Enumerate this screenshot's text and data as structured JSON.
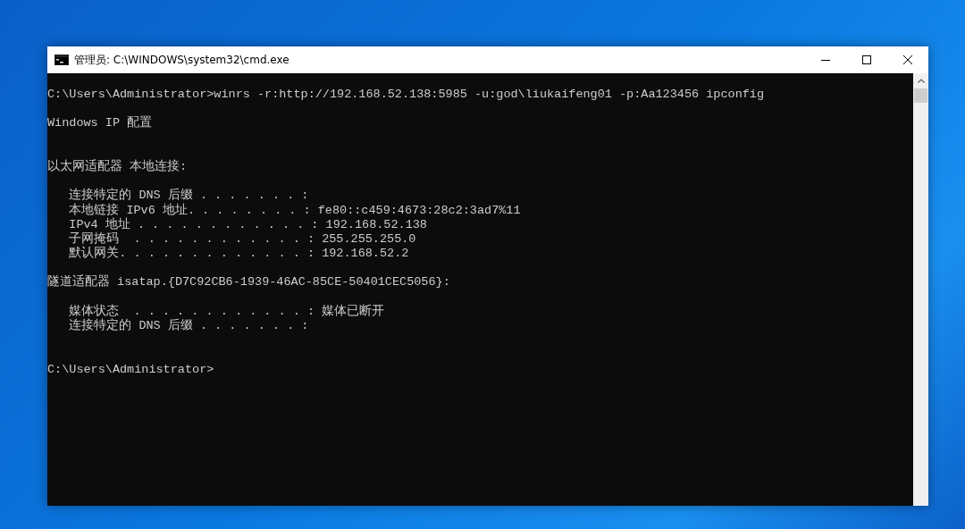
{
  "window": {
    "title": "管理员: C:\\WINDOWS\\system32\\cmd.exe"
  },
  "console": {
    "lines": [
      {
        "kind": "text",
        "text": "C:\\Users\\Administrator>winrs -r:http://192.168.52.138:5985 -u:god\\liukaifeng01 -p:Aa123456 ipconfig"
      },
      {
        "kind": "blank"
      },
      {
        "kind": "text",
        "text": "Windows IP 配置"
      },
      {
        "kind": "blank"
      },
      {
        "kind": "blank"
      },
      {
        "kind": "text",
        "text": "以太网适配器 本地连接:"
      },
      {
        "kind": "blank"
      },
      {
        "kind": "text",
        "text": "   连接特定的 DNS 后缀 . . . . . . . :"
      },
      {
        "kind": "text",
        "text": "   本地链接 IPv6 地址. . . . . . . . : fe80::c459:4673:28c2:3ad7%11"
      },
      {
        "kind": "text",
        "text": "   IPv4 地址 . . . . . . . . . . . . : 192.168.52.138"
      },
      {
        "kind": "text",
        "text": "   子网掩码  . . . . . . . . . . . . : 255.255.255.0"
      },
      {
        "kind": "text",
        "text": "   默认网关. . . . . . . . . . . . . : 192.168.52.2"
      },
      {
        "kind": "blank"
      },
      {
        "kind": "text",
        "text": "隧道适配器 isatap.{D7C92CB6-1939-46AC-85CE-50401CEC5056}:"
      },
      {
        "kind": "blank"
      },
      {
        "kind": "text",
        "text": "   媒体状态  . . . . . . . . . . . . : 媒体已断开"
      },
      {
        "kind": "text",
        "text": "   连接特定的 DNS 后缀 . . . . . . . :"
      },
      {
        "kind": "blank"
      },
      {
        "kind": "blank"
      },
      {
        "kind": "text",
        "text": "C:\\Users\\Administrator>"
      }
    ]
  }
}
